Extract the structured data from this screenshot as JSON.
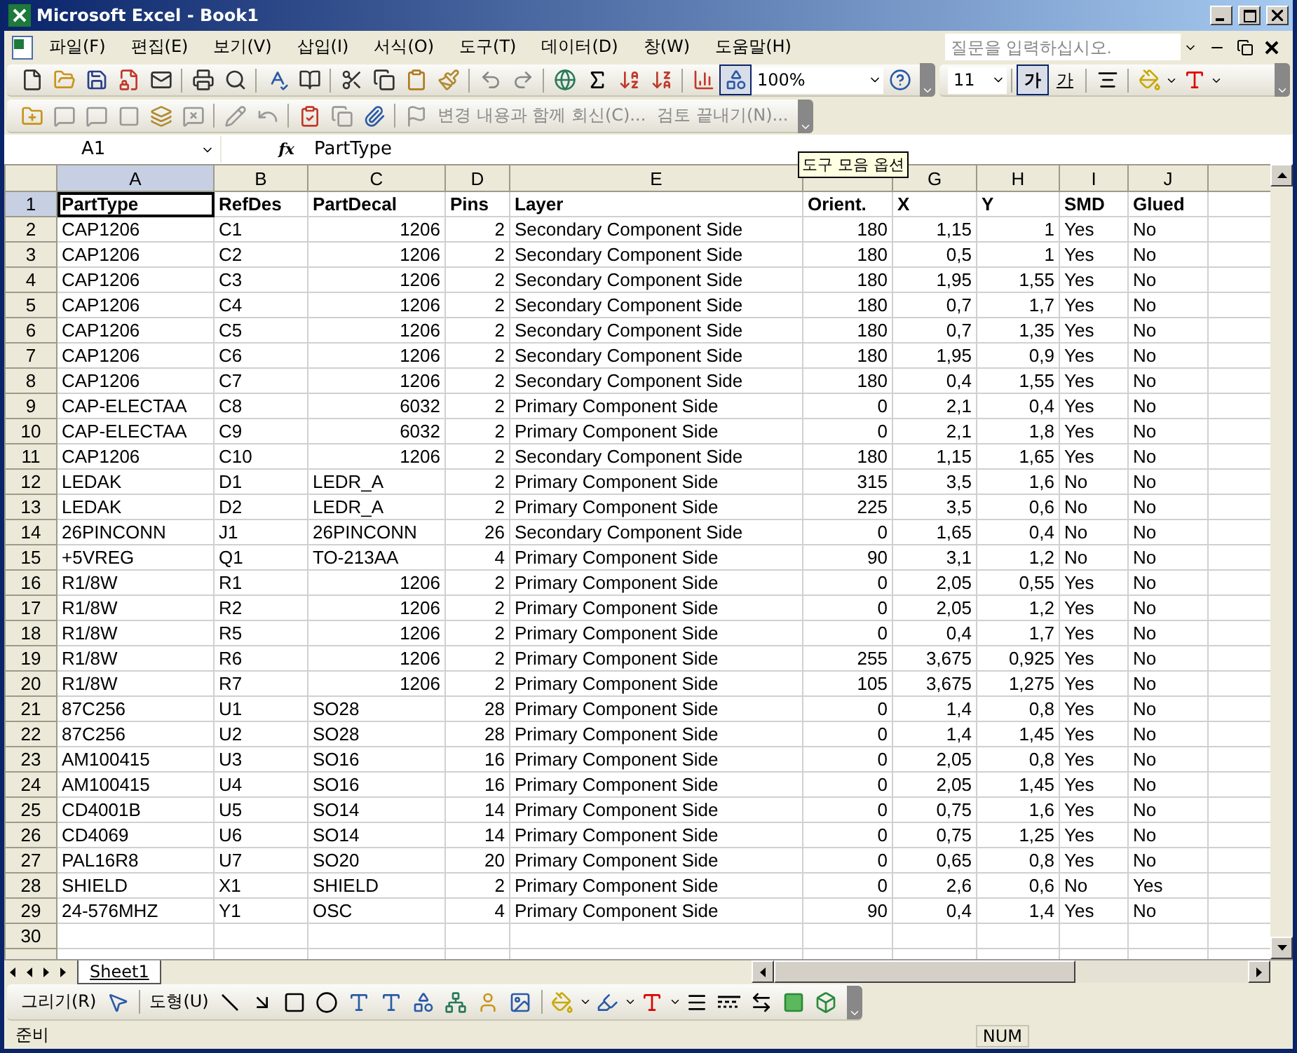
{
  "window": {
    "title": "Microsoft Excel - Book1"
  },
  "menu": [
    {
      "label": "파일(F)"
    },
    {
      "label": "편집(E)"
    },
    {
      "label": "보기(V)"
    },
    {
      "label": "삽입(I)"
    },
    {
      "label": "서식(O)"
    },
    {
      "label": "도구(T)"
    },
    {
      "label": "데이터(D)"
    },
    {
      "label": "창(W)"
    },
    {
      "label": "도움말(H)"
    }
  ],
  "help_search": {
    "placeholder": "질문을 입력하십시오."
  },
  "standard_toolbar": {
    "zoom": "100%",
    "drawing_pressed": true
  },
  "formatting_toolbar": {
    "font_size": "11",
    "bold": {
      "label": "가",
      "pressed": true
    },
    "underline": {
      "label": "가",
      "pressed": false
    }
  },
  "reviewing_toolbar": {
    "buttons": [
      {
        "label": "변경 내용과 함께 회신(C)..."
      },
      {
        "label": "검토 끝내기(N)..."
      }
    ]
  },
  "tooltip": "도구 모음 옵션",
  "formula_bar": {
    "name_box": "A1",
    "function_label": "fx",
    "content": "PartType"
  },
  "sheet": {
    "columns": [
      {
        "letter": "A",
        "selected": true
      },
      {
        "letter": "B",
        "selected": false
      },
      {
        "letter": "C",
        "selected": false
      },
      {
        "letter": "D",
        "selected": false
      },
      {
        "letter": "E",
        "selected": false
      },
      {
        "selected": false
      },
      {
        "letter": "G",
        "selected": false
      },
      {
        "letter": "H",
        "selected": false
      },
      {
        "letter": "I",
        "selected": false
      },
      {
        "letter": "J",
        "selected": false
      }
    ],
    "rows": [
      {
        "number": "1",
        "selected": true,
        "header": true,
        "cells": [
          "PartType",
          "RefDes",
          "PartDecal",
          "Pins",
          "Layer",
          "Orient.",
          "X",
          "Y",
          "SMD",
          "Glued"
        ]
      },
      {
        "number": "2",
        "selected": false,
        "decal_numeric": true,
        "cells": [
          "CAP1206",
          "C1",
          "1206",
          "2",
          "Secondary Component Side",
          "180",
          "1,15",
          "1",
          "Yes",
          "No"
        ]
      },
      {
        "number": "3",
        "selected": false,
        "decal_numeric": true,
        "cells": [
          "CAP1206",
          "C2",
          "1206",
          "2",
          "Secondary Component Side",
          "180",
          "0,5",
          "1",
          "Yes",
          "No"
        ]
      },
      {
        "number": "4",
        "selected": false,
        "decal_numeric": true,
        "cells": [
          "CAP1206",
          "C3",
          "1206",
          "2",
          "Secondary Component Side",
          "180",
          "1,95",
          "1,55",
          "Yes",
          "No"
        ]
      },
      {
        "number": "5",
        "selected": false,
        "decal_numeric": true,
        "cells": [
          "CAP1206",
          "C4",
          "1206",
          "2",
          "Secondary Component Side",
          "180",
          "0,7",
          "1,7",
          "Yes",
          "No"
        ]
      },
      {
        "number": "6",
        "selected": false,
        "decal_numeric": true,
        "cells": [
          "CAP1206",
          "C5",
          "1206",
          "2",
          "Secondary Component Side",
          "180",
          "0,7",
          "1,35",
          "Yes",
          "No"
        ]
      },
      {
        "number": "7",
        "selected": false,
        "decal_numeric": true,
        "cells": [
          "CAP1206",
          "C6",
          "1206",
          "2",
          "Secondary Component Side",
          "180",
          "1,95",
          "0,9",
          "Yes",
          "No"
        ]
      },
      {
        "number": "8",
        "selected": false,
        "decal_numeric": true,
        "cells": [
          "CAP1206",
          "C7",
          "1206",
          "2",
          "Secondary Component Side",
          "180",
          "0,4",
          "1,55",
          "Yes",
          "No"
        ]
      },
      {
        "number": "9",
        "selected": false,
        "decal_numeric": true,
        "cells": [
          "CAP-ELECTAA",
          "C8",
          "6032",
          "2",
          "Primary Component Side",
          "0",
          "2,1",
          "0,4",
          "Yes",
          "No"
        ]
      },
      {
        "number": "10",
        "selected": false,
        "decal_numeric": true,
        "cells": [
          "CAP-ELECTAA",
          "C9",
          "6032",
          "2",
          "Primary Component Side",
          "0",
          "2,1",
          "1,8",
          "Yes",
          "No"
        ]
      },
      {
        "number": "11",
        "selected": false,
        "decal_numeric": true,
        "cells": [
          "CAP1206",
          "C10",
          "1206",
          "2",
          "Secondary Component Side",
          "180",
          "1,15",
          "1,65",
          "Yes",
          "No"
        ]
      },
      {
        "number": "12",
        "selected": false,
        "decal_numeric": false,
        "cells": [
          "LEDAK",
          "D1",
          "LEDR_A",
          "2",
          "Primary Component Side",
          "315",
          "3,5",
          "1,6",
          "No",
          "No"
        ]
      },
      {
        "number": "13",
        "selected": false,
        "decal_numeric": false,
        "cells": [
          "LEDAK",
          "D2",
          "LEDR_A",
          "2",
          "Primary Component Side",
          "225",
          "3,5",
          "0,6",
          "No",
          "No"
        ]
      },
      {
        "number": "14",
        "selected": false,
        "decal_numeric": false,
        "cells": [
          "26PINCONN",
          "J1",
          "26PINCONN",
          "26",
          "Secondary Component Side",
          "0",
          "1,65",
          "0,4",
          "No",
          "No"
        ]
      },
      {
        "number": "15",
        "selected": false,
        "decal_numeric": false,
        "cells": [
          "+5VREG",
          "Q1",
          "TO-213AA",
          "4",
          "Primary Component Side",
          "90",
          "3,1",
          "1,2",
          "No",
          "No"
        ]
      },
      {
        "number": "16",
        "selected": false,
        "decal_numeric": true,
        "cells": [
          "R1/8W",
          "R1",
          "1206",
          "2",
          "Primary Component Side",
          "0",
          "2,05",
          "0,55",
          "Yes",
          "No"
        ]
      },
      {
        "number": "17",
        "selected": false,
        "decal_numeric": true,
        "cells": [
          "R1/8W",
          "R2",
          "1206",
          "2",
          "Primary Component Side",
          "0",
          "2,05",
          "1,2",
          "Yes",
          "No"
        ]
      },
      {
        "number": "18",
        "selected": false,
        "decal_numeric": true,
        "cells": [
          "R1/8W",
          "R5",
          "1206",
          "2",
          "Primary Component Side",
          "0",
          "0,4",
          "1,7",
          "Yes",
          "No"
        ]
      },
      {
        "number": "19",
        "selected": false,
        "decal_numeric": true,
        "cells": [
          "R1/8W",
          "R6",
          "1206",
          "2",
          "Primary Component Side",
          "255",
          "3,675",
          "0,925",
          "Yes",
          "No"
        ]
      },
      {
        "number": "20",
        "selected": false,
        "decal_numeric": true,
        "cells": [
          "R1/8W",
          "R7",
          "1206",
          "2",
          "Primary Component Side",
          "105",
          "3,675",
          "1,275",
          "Yes",
          "No"
        ]
      },
      {
        "number": "21",
        "selected": false,
        "decal_numeric": false,
        "cells": [
          "87C256",
          "U1",
          "SO28",
          "28",
          "Primary Component Side",
          "0",
          "1,4",
          "0,8",
          "Yes",
          "No"
        ]
      },
      {
        "number": "22",
        "selected": false,
        "decal_numeric": false,
        "cells": [
          "87C256",
          "U2",
          "SO28",
          "28",
          "Primary Component Side",
          "0",
          "1,4",
          "1,45",
          "Yes",
          "No"
        ]
      },
      {
        "number": "23",
        "selected": false,
        "decal_numeric": false,
        "cells": [
          "AM100415",
          "U3",
          "SO16",
          "16",
          "Primary Component Side",
          "0",
          "2,05",
          "0,8",
          "Yes",
          "No"
        ]
      },
      {
        "number": "24",
        "selected": false,
        "decal_numeric": false,
        "cells": [
          "AM100415",
          "U4",
          "SO16",
          "16",
          "Primary Component Side",
          "0",
          "2,05",
          "1,45",
          "Yes",
          "No"
        ]
      },
      {
        "number": "25",
        "selected": false,
        "decal_numeric": false,
        "cells": [
          "CD4001B",
          "U5",
          "SO14",
          "14",
          "Primary Component Side",
          "0",
          "0,75",
          "1,6",
          "Yes",
          "No"
        ]
      },
      {
        "number": "26",
        "selected": false,
        "decal_numeric": false,
        "cells": [
          "CD4069",
          "U6",
          "SO14",
          "14",
          "Primary Component Side",
          "0",
          "0,75",
          "1,25",
          "Yes",
          "No"
        ]
      },
      {
        "number": "27",
        "selected": false,
        "decal_numeric": false,
        "cells": [
          "PAL16R8",
          "U7",
          "SO20",
          "20",
          "Primary Component Side",
          "0",
          "0,65",
          "0,8",
          "Yes",
          "No"
        ]
      },
      {
        "number": "28",
        "selected": false,
        "decal_numeric": false,
        "cells": [
          "SHIELD",
          "X1",
          "SHIELD",
          "2",
          "Primary Component Side",
          "0",
          "2,6",
          "0,6",
          "No",
          "Yes"
        ]
      },
      {
        "number": "29",
        "selected": false,
        "decal_numeric": false,
        "cells": [
          "24-576MHZ",
          "Y1",
          "OSC",
          "4",
          "Primary Component Side",
          "90",
          "0,4",
          "1,4",
          "Yes",
          "No"
        ]
      },
      {
        "number": "30",
        "selected": false,
        "cells": []
      }
    ]
  },
  "sheet_tabs": [
    {
      "label": "Sheet1",
      "selected": true
    }
  ],
  "drawing_toolbar": {
    "draw_menu": "그리기(R)",
    "autoshapes_menu": "도형(U)"
  },
  "status_bar": {
    "mode": "준비",
    "indicators": [
      "NUM"
    ]
  }
}
